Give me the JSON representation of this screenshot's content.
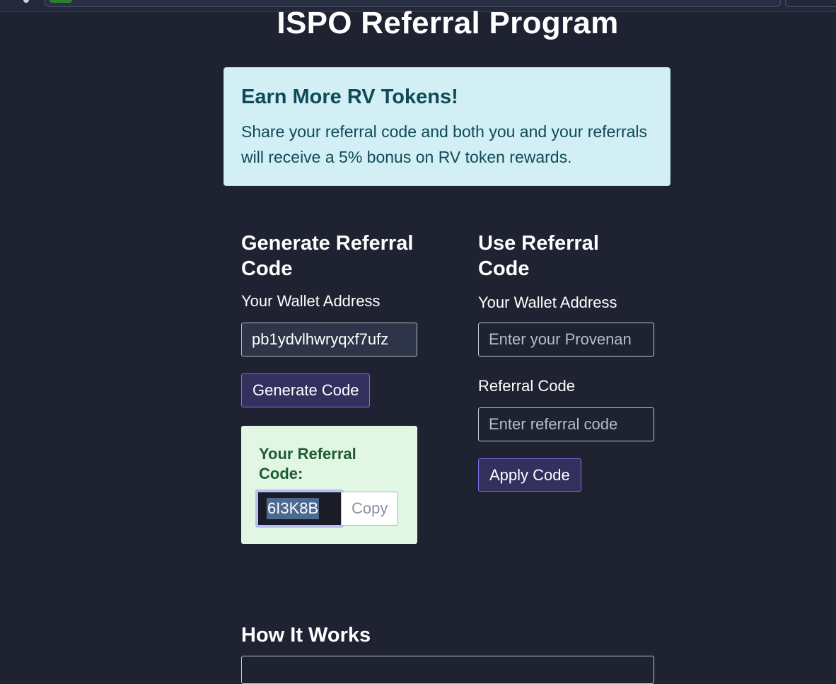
{
  "page": {
    "title": "ISPO Referral Program"
  },
  "info": {
    "title": "Earn More RV Tokens!",
    "text": "Share your referral code and both you and your referrals will receive a 5% bonus on RV token rewards."
  },
  "generate": {
    "heading": "Generate Referral Code",
    "wallet_label": "Your Wallet Address",
    "wallet_value": "pb1ydvlhwryqxf7ufz",
    "button_label": "Generate Code",
    "result_label": "Your Referral Code:",
    "code_value": "6I3K8B",
    "copy_label": "Copy"
  },
  "use": {
    "heading": "Use Referral Code",
    "wallet_label": "Your Wallet Address",
    "wallet_placeholder": "Enter your Provenan",
    "code_label": "Referral Code",
    "code_placeholder": "Enter referral code",
    "button_label": "Apply Code"
  },
  "how": {
    "heading": "How It Works"
  },
  "colors": {
    "background": "#1e2231",
    "info_bg": "#d1eff5",
    "info_text": "#0f4a57",
    "result_bg": "#e1f6e3",
    "result_text": "#1f5c34",
    "button_bg": "#33305e",
    "button_border": "#7c74e8"
  }
}
